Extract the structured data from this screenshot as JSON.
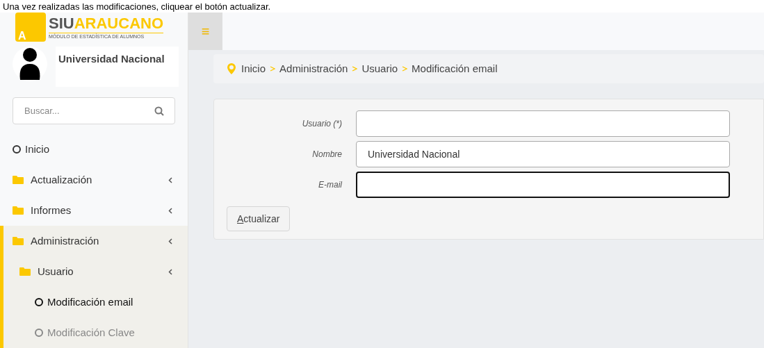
{
  "caption": "Una vez realizadas las modificaciones, cliquear el botón actualizar.",
  "logo": {
    "brand_dark": "SIU",
    "brand_accent": "ARAUCANO",
    "subtitle": "MÓDULO DE ESTADÍSTICA DE ALUMNOS",
    "letter": "A"
  },
  "top_bar": {
    "menu_icon": "≡"
  },
  "user": {
    "name": "Universidad Nacional"
  },
  "search": {
    "placeholder": "Buscar..."
  },
  "sidebar": {
    "items": [
      {
        "kind": "link",
        "label": "Inicio",
        "selected": false
      },
      {
        "kind": "folder",
        "label": "Actualización",
        "expanded": false
      },
      {
        "kind": "folder",
        "label": "Informes",
        "expanded": false
      },
      {
        "kind": "folder",
        "label": "Administración",
        "expanded": true,
        "children": [
          {
            "kind": "folder",
            "label": "Usuario",
            "expanded": true,
            "children": [
              {
                "kind": "link",
                "label": "Modificación email",
                "selected": true
              },
              {
                "kind": "link",
                "label": "Modificación Clave",
                "selected": false
              }
            ]
          }
        ]
      }
    ]
  },
  "breadcrumb": [
    "Inicio",
    "Administración",
    "Usuario",
    "Modificación email"
  ],
  "form": {
    "fields": [
      {
        "label": "Usuario (*)",
        "focused": false
      },
      {
        "label": "Nombre",
        "value": "Universidad Nacional",
        "focused": false
      },
      {
        "label": "E-mail",
        "focused": true
      }
    ],
    "button": "Actualizar"
  }
}
